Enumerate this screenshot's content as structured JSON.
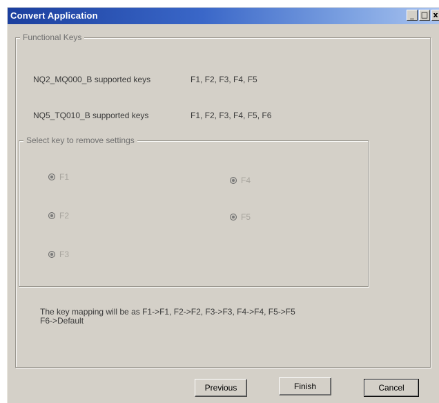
{
  "window": {
    "title": "Convert Application",
    "caption": {
      "minimize": "_",
      "maximize": "□",
      "close": "x"
    }
  },
  "functional_keys": {
    "group_title": "Functional Keys",
    "rows": [
      {
        "device": "NQ2_MQ000_B supported keys",
        "keys": "F1, F2, F3, F4, F5"
      },
      {
        "device": "NQ5_TQ010_B supported keys",
        "keys": "F1, F2, F3, F4, F5, F6"
      }
    ]
  },
  "remove_settings": {
    "group_title": "Select key to remove settings",
    "options": [
      {
        "label": "F1",
        "enabled": false
      },
      {
        "label": "F2",
        "enabled": false
      },
      {
        "label": "F3",
        "enabled": false
      },
      {
        "label": "F4",
        "enabled": false
      },
      {
        "label": "F5",
        "enabled": false
      }
    ]
  },
  "mapping_note": {
    "line1": "The key mapping will be as F1->F1, F2->F2, F3->F3, F4->F4, F5->F5",
    "line2": "F6->Default"
  },
  "buttons": {
    "previous": "Previous",
    "finish": "Finish",
    "cancel": "Cancel"
  }
}
